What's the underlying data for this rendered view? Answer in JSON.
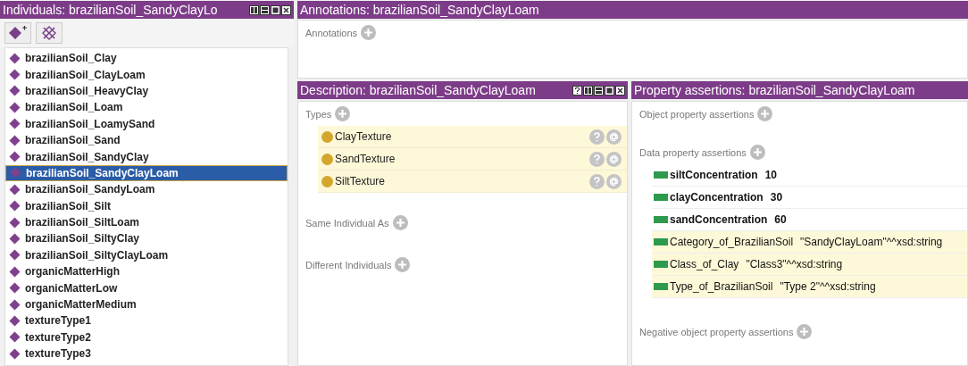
{
  "individuals": {
    "title": "Individuals: brazilianSoil_SandyClayLo",
    "items": [
      {
        "label": "brazilianSoil_Clay",
        "selected": false
      },
      {
        "label": "brazilianSoil_ClayLoam",
        "selected": false
      },
      {
        "label": "brazilianSoil_HeavyClay",
        "selected": false
      },
      {
        "label": "brazilianSoil_Loam",
        "selected": false
      },
      {
        "label": "brazilianSoil_LoamySand",
        "selected": false
      },
      {
        "label": "brazilianSoil_Sand",
        "selected": false
      },
      {
        "label": "brazilianSoil_SandyClay",
        "selected": false
      },
      {
        "label": "brazilianSoil_SandyClayLoam",
        "selected": true
      },
      {
        "label": "brazilianSoil_SandyLoam",
        "selected": false
      },
      {
        "label": "brazilianSoil_Silt",
        "selected": false
      },
      {
        "label": "brazilianSoil_SiltLoam",
        "selected": false
      },
      {
        "label": "brazilianSoil_SiltyClay",
        "selected": false
      },
      {
        "label": "brazilianSoil_SiltyClayLoam",
        "selected": false
      },
      {
        "label": "organicMatterHigh",
        "selected": false
      },
      {
        "label": "organicMatterLow",
        "selected": false
      },
      {
        "label": "organicMatterMedium",
        "selected": false
      },
      {
        "label": "textureType1",
        "selected": false
      },
      {
        "label": "textureType2",
        "selected": false
      },
      {
        "label": "textureType3",
        "selected": false
      }
    ]
  },
  "annotations": {
    "title": "Annotations: brazilianSoil_SandyClayLoam",
    "section": "Annotations"
  },
  "description": {
    "title": "Description: brazilianSoil_SandyClayLoam",
    "types": {
      "label": "Types",
      "items": [
        {
          "label": "ClayTexture",
          "inferred": true
        },
        {
          "label": "SandTexture",
          "inferred": true
        },
        {
          "label": "SiltTexture",
          "inferred": true
        }
      ]
    },
    "same_individual_as": "Same Individual As",
    "different_individuals": "Different Individuals"
  },
  "property_assertions": {
    "title": "Property assertions: brazilianSoil_SandyClayLoam",
    "object_property_assertions": "Object property assertions",
    "data_property_assertions": {
      "label": "Data property assertions",
      "items": [
        {
          "property": "siltConcentration",
          "value": "10",
          "inferred": false
        },
        {
          "property": "clayConcentration",
          "value": "30",
          "inferred": false
        },
        {
          "property": "sandConcentration",
          "value": "60",
          "inferred": false
        },
        {
          "property": "Category_of_BrazilianSoil",
          "value": "\"SandyClayLoam\"^^xsd:string",
          "inferred": true
        },
        {
          "property": "Class_of_Clay",
          "value": "\"Class3\"^^xsd:string",
          "inferred": true
        },
        {
          "property": "Type_of_BrazilianSoil",
          "value": "\"Type 2\"^^xsd:string",
          "inferred": true
        }
      ]
    },
    "negative_object_property_assertions": "Negative object property assertions"
  }
}
